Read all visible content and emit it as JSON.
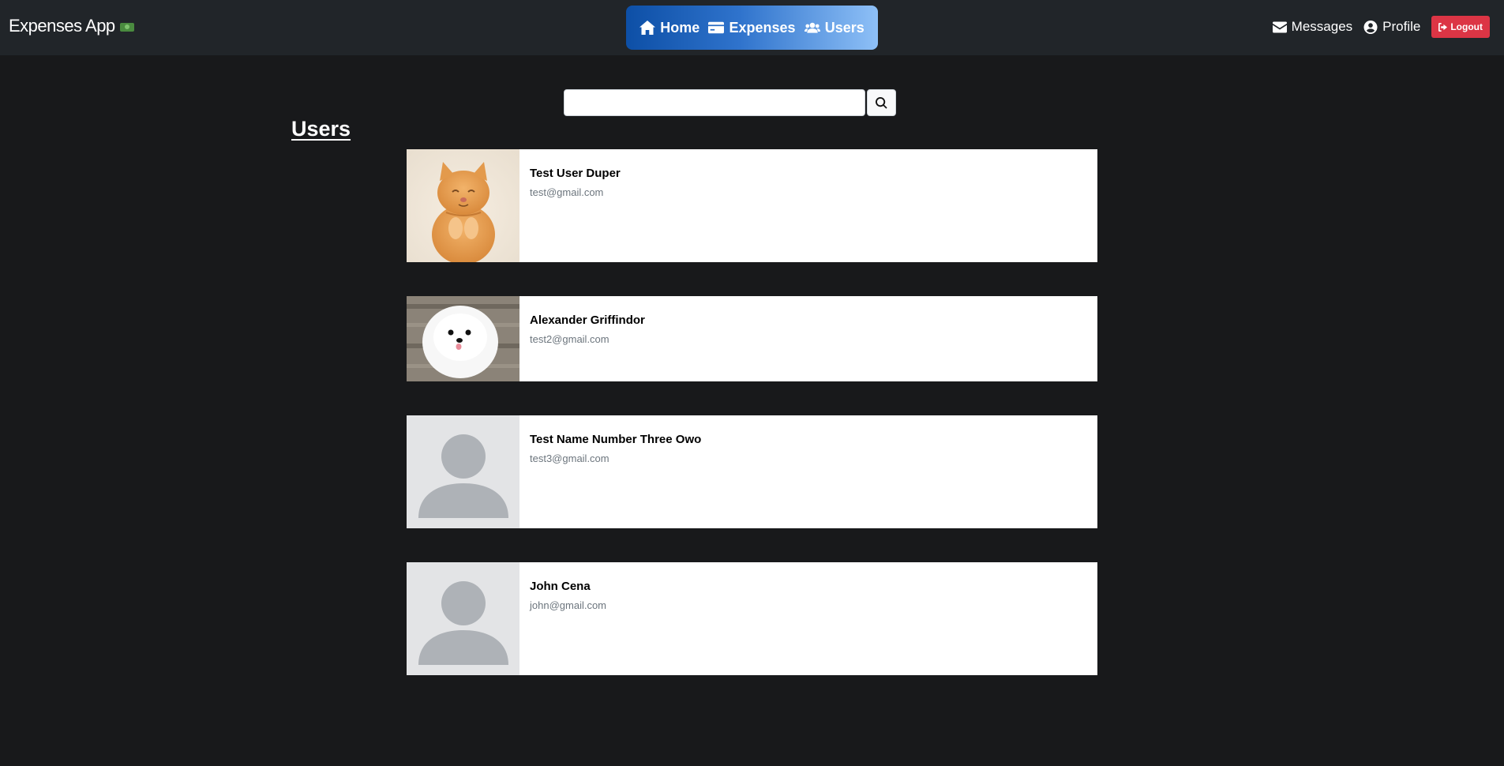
{
  "app": {
    "brand": "Expenses App"
  },
  "nav": {
    "home_label": "Home",
    "expenses_label": "Expenses",
    "users_label": "Users",
    "messages_label": "Messages",
    "profile_label": "Profile",
    "logout_label": "Logout"
  },
  "search": {
    "placeholder": "",
    "value": ""
  },
  "page": {
    "title": "Users"
  },
  "users": [
    {
      "name": "Test User Duper",
      "email": "test@gmail.com",
      "avatar": "cat-photo"
    },
    {
      "name": "Alexander Griffindor",
      "email": "test2@gmail.com",
      "avatar": "dog-photo"
    },
    {
      "name": "Test Name Number Three Owo",
      "email": "test3@gmail.com",
      "avatar": "default-avatar"
    },
    {
      "name": "John Cena",
      "email": "john@gmail.com",
      "avatar": "default-avatar"
    }
  ],
  "colors": {
    "background": "#18191b",
    "navbar": "#212529",
    "logout": "#dc3545",
    "email_text": "#6c757d"
  }
}
